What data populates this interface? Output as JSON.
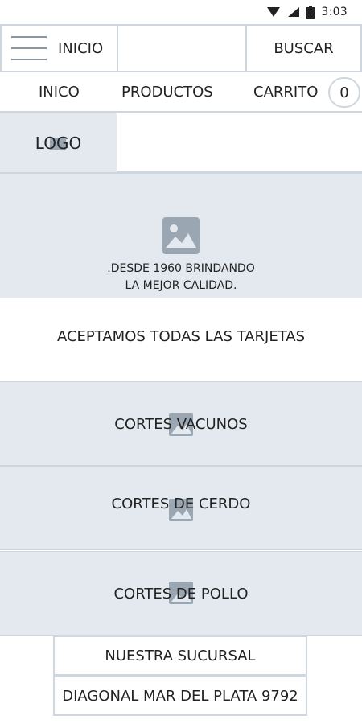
{
  "status_bar": {
    "time": "3:03",
    "icons": [
      "wifi-icon",
      "signal-icon",
      "battery-icon"
    ]
  },
  "top_bar": {
    "menu_label": "INICIO",
    "search": {
      "value": "",
      "placeholder": ""
    },
    "search_button_label": "BUSCAR"
  },
  "nav": {
    "items": [
      {
        "label": "INICO"
      },
      {
        "label": "PRODUCTOS"
      },
      {
        "label": "CARRITO"
      }
    ],
    "cart_count": "0"
  },
  "logo": {
    "label": "LOGO"
  },
  "hero": {
    "line1": ".DESDE 1960 BRINDANDO",
    "line2": "LA MEJOR CALIDAD."
  },
  "cards_notice": "ACEPTAMOS TODAS LAS TARJETAS",
  "categories": [
    {
      "label": "CORTES VACUNOS"
    },
    {
      "label": "CORTES DE CERDO"
    },
    {
      "label": "CORTES DE POLLO"
    }
  ],
  "branch": {
    "title": "NUESTRA SUCURSAL",
    "address": "DIAGONAL MAR DEL PLATA 9792"
  },
  "colors": {
    "placeholder_bg": "#e4e9ef",
    "border": "#cfd6de",
    "icon": "#9aa6b2"
  }
}
